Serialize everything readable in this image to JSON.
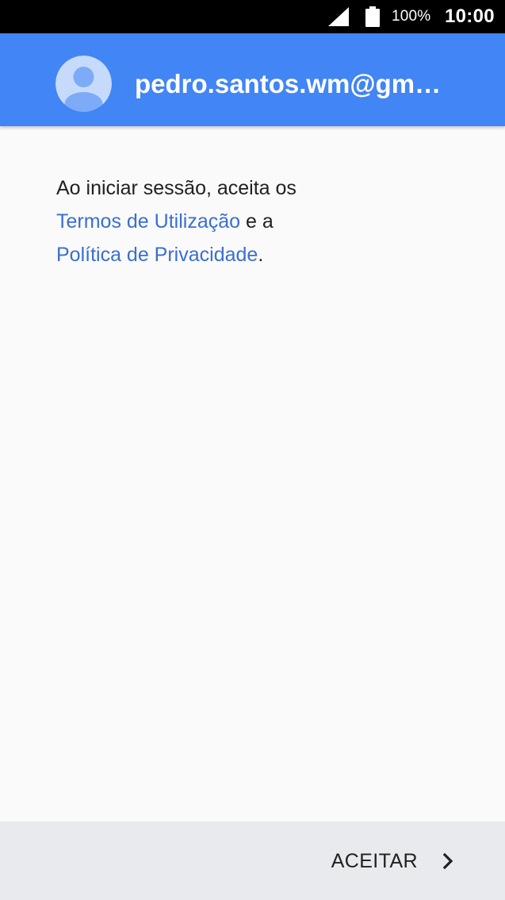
{
  "status_bar": {
    "battery_percent": "100%",
    "time": "10:00"
  },
  "header": {
    "account_email": "pedro.santos.wm@gmail.com",
    "avatar_icon": "account-circle-icon"
  },
  "terms": {
    "intro": "Ao iniciar sessão, aceita os",
    "terms_link": "Termos de Utilização",
    "connector": " e a",
    "privacy_link": "Política de Privacidade",
    "end": "."
  },
  "footer": {
    "accept_label": "ACEITAR",
    "chevron_icon": "chevron-right-icon"
  },
  "colors": {
    "header_blue": "#4285f4",
    "link_blue": "#3a6fd0",
    "background": "#fafafa",
    "footer_gray": "#e8eaed"
  }
}
